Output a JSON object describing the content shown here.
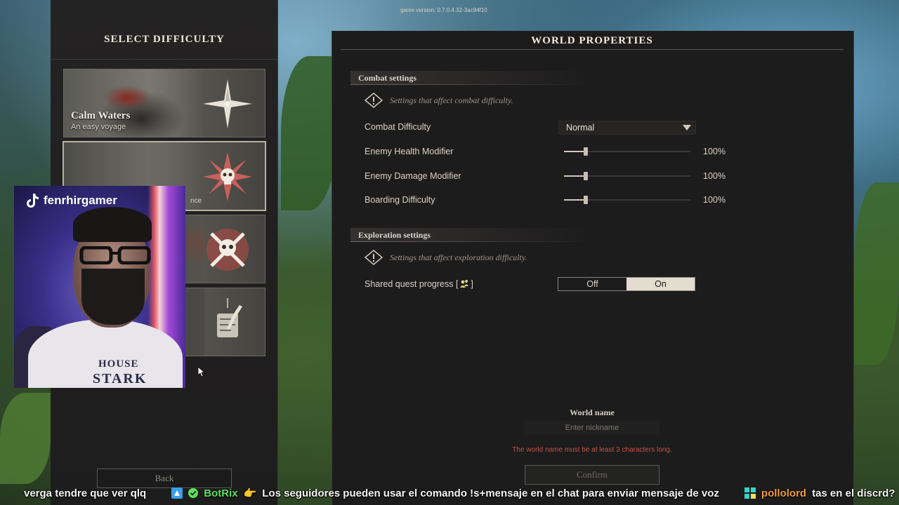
{
  "game": {
    "version": "game version: 0.7.0.4.32-3ac94f10"
  },
  "difficulty_panel": {
    "title": "SELECT DIFFICULTY",
    "cards": [
      {
        "title": "Calm Waters",
        "subtitle": "An easy voyage",
        "emblem": "compass-star-icon"
      },
      {
        "subtitle_partial": "nce",
        "emblem": "skull-star-icon"
      },
      {
        "emblem": "skull-crossbones-icon"
      },
      {
        "emblem": "quill-scroll-icon"
      }
    ],
    "back_label": "Back"
  },
  "webcam": {
    "handle": "fenrhirgamer",
    "shirt_line1": "HOUSE",
    "shirt_line2": "STARK"
  },
  "world_properties": {
    "title": "WORLD PROPERTIES",
    "combat": {
      "heading": "Combat settings",
      "info": "Settings that affect combat difficulty.",
      "rows": [
        {
          "label": "Combat Difficulty",
          "value": "Normal"
        },
        {
          "label": "Enemy Health Modifier",
          "value": "100%",
          "level": 0.17
        },
        {
          "label": "Enemy Damage Modifier",
          "value": "100%",
          "level": 0.17
        },
        {
          "label": "Boarding Difficulty",
          "value": "100%",
          "level": 0.17
        }
      ]
    },
    "exploration": {
      "heading": "Exploration settings",
      "info": "Settings that affect exploration difficulty.",
      "shared_quest_label": "Shared quest progress [",
      "shared_quest_suffix": "]",
      "toggle_off": "Off",
      "toggle_on": "On",
      "toggle_selected": "On"
    },
    "world_name": {
      "label": "World name",
      "placeholder": "Enter nickname",
      "error": "The world name must be at least 3 characters long."
    },
    "confirm_label": "Confirm"
  },
  "chat_ticker": {
    "msg1": "verga tendre que ver qlq",
    "user2": "BotRix",
    "msg2": "Los seguidores pueden usar el comando !s+mensaje en el chat para enviar mensaje de voz",
    "user3": "pollolord",
    "msg3": "tas en el discrd?"
  },
  "colors": {
    "panel_bg": "#1d1c1c",
    "accent_text": "#f1ece2",
    "error": "#c2524a",
    "toggle_on_bg": "#e3ddd0",
    "chat_green": "#5fe05a",
    "chat_orange": "#f29a3a"
  }
}
